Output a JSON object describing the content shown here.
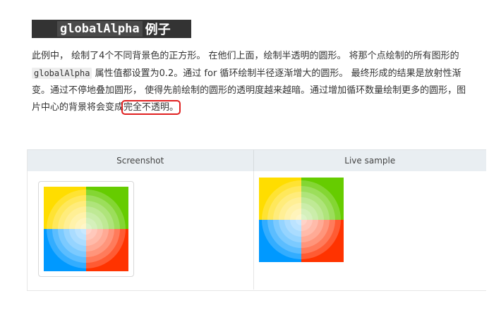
{
  "heading": {
    "code": "globalAlpha",
    "suffix": "例子"
  },
  "paragraph": {
    "p1": "此例中， 绘制了4个不同背景色的正方形。 在他们上面，绘制半透明的圆形。 将那个点绘制的所有图形的 ",
    "code": "globalAlpha",
    "p2": " 属性值都设置为0.2。通过 for 循环绘制半径逐渐增大的圆形。 最终形成的结果是放射性渐变。通过不停地叠加圆形， 使得先前绘制的圆形的透明度越来越暗。通过增加循环数量绘制更多的圆形，图片中心的背景将会变成",
    "highlight": "完全不透明。"
  },
  "table": {
    "col_screenshot": "Screenshot",
    "col_live": "Live sample"
  },
  "colors": {
    "yellow": "#FFDD00",
    "green": "#66CC00",
    "blue": "#0099FF",
    "red": "#FF3300",
    "highlight_border": "#e02020"
  }
}
